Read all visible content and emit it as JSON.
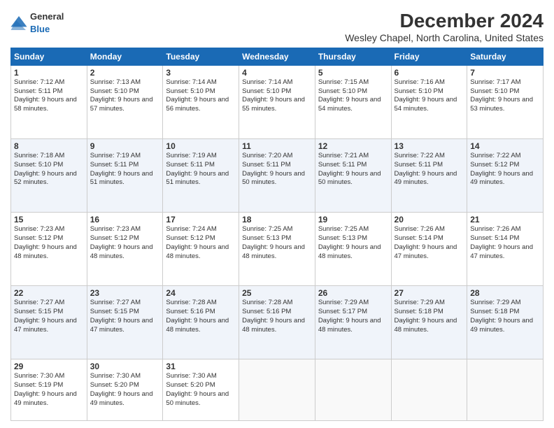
{
  "header": {
    "logo_general": "General",
    "logo_blue": "Blue",
    "month_title": "December 2024",
    "location": "Wesley Chapel, North Carolina, United States"
  },
  "weekdays": [
    "Sunday",
    "Monday",
    "Tuesday",
    "Wednesday",
    "Thursday",
    "Friday",
    "Saturday"
  ],
  "weeks": [
    [
      {
        "day": "1",
        "sunrise": "Sunrise: 7:12 AM",
        "sunset": "Sunset: 5:11 PM",
        "daylight": "Daylight: 9 hours and 58 minutes."
      },
      {
        "day": "2",
        "sunrise": "Sunrise: 7:13 AM",
        "sunset": "Sunset: 5:10 PM",
        "daylight": "Daylight: 9 hours and 57 minutes."
      },
      {
        "day": "3",
        "sunrise": "Sunrise: 7:14 AM",
        "sunset": "Sunset: 5:10 PM",
        "daylight": "Daylight: 9 hours and 56 minutes."
      },
      {
        "day": "4",
        "sunrise": "Sunrise: 7:14 AM",
        "sunset": "Sunset: 5:10 PM",
        "daylight": "Daylight: 9 hours and 55 minutes."
      },
      {
        "day": "5",
        "sunrise": "Sunrise: 7:15 AM",
        "sunset": "Sunset: 5:10 PM",
        "daylight": "Daylight: 9 hours and 54 minutes."
      },
      {
        "day": "6",
        "sunrise": "Sunrise: 7:16 AM",
        "sunset": "Sunset: 5:10 PM",
        "daylight": "Daylight: 9 hours and 54 minutes."
      },
      {
        "day": "7",
        "sunrise": "Sunrise: 7:17 AM",
        "sunset": "Sunset: 5:10 PM",
        "daylight": "Daylight: 9 hours and 53 minutes."
      }
    ],
    [
      {
        "day": "8",
        "sunrise": "Sunrise: 7:18 AM",
        "sunset": "Sunset: 5:10 PM",
        "daylight": "Daylight: 9 hours and 52 minutes."
      },
      {
        "day": "9",
        "sunrise": "Sunrise: 7:19 AM",
        "sunset": "Sunset: 5:11 PM",
        "daylight": "Daylight: 9 hours and 51 minutes."
      },
      {
        "day": "10",
        "sunrise": "Sunrise: 7:19 AM",
        "sunset": "Sunset: 5:11 PM",
        "daylight": "Daylight: 9 hours and 51 minutes."
      },
      {
        "day": "11",
        "sunrise": "Sunrise: 7:20 AM",
        "sunset": "Sunset: 5:11 PM",
        "daylight": "Daylight: 9 hours and 50 minutes."
      },
      {
        "day": "12",
        "sunrise": "Sunrise: 7:21 AM",
        "sunset": "Sunset: 5:11 PM",
        "daylight": "Daylight: 9 hours and 50 minutes."
      },
      {
        "day": "13",
        "sunrise": "Sunrise: 7:22 AM",
        "sunset": "Sunset: 5:11 PM",
        "daylight": "Daylight: 9 hours and 49 minutes."
      },
      {
        "day": "14",
        "sunrise": "Sunrise: 7:22 AM",
        "sunset": "Sunset: 5:12 PM",
        "daylight": "Daylight: 9 hours and 49 minutes."
      }
    ],
    [
      {
        "day": "15",
        "sunrise": "Sunrise: 7:23 AM",
        "sunset": "Sunset: 5:12 PM",
        "daylight": "Daylight: 9 hours and 48 minutes."
      },
      {
        "day": "16",
        "sunrise": "Sunrise: 7:23 AM",
        "sunset": "Sunset: 5:12 PM",
        "daylight": "Daylight: 9 hours and 48 minutes."
      },
      {
        "day": "17",
        "sunrise": "Sunrise: 7:24 AM",
        "sunset": "Sunset: 5:12 PM",
        "daylight": "Daylight: 9 hours and 48 minutes."
      },
      {
        "day": "18",
        "sunrise": "Sunrise: 7:25 AM",
        "sunset": "Sunset: 5:13 PM",
        "daylight": "Daylight: 9 hours and 48 minutes."
      },
      {
        "day": "19",
        "sunrise": "Sunrise: 7:25 AM",
        "sunset": "Sunset: 5:13 PM",
        "daylight": "Daylight: 9 hours and 48 minutes."
      },
      {
        "day": "20",
        "sunrise": "Sunrise: 7:26 AM",
        "sunset": "Sunset: 5:14 PM",
        "daylight": "Daylight: 9 hours and 47 minutes."
      },
      {
        "day": "21",
        "sunrise": "Sunrise: 7:26 AM",
        "sunset": "Sunset: 5:14 PM",
        "daylight": "Daylight: 9 hours and 47 minutes."
      }
    ],
    [
      {
        "day": "22",
        "sunrise": "Sunrise: 7:27 AM",
        "sunset": "Sunset: 5:15 PM",
        "daylight": "Daylight: 9 hours and 47 minutes."
      },
      {
        "day": "23",
        "sunrise": "Sunrise: 7:27 AM",
        "sunset": "Sunset: 5:15 PM",
        "daylight": "Daylight: 9 hours and 47 minutes."
      },
      {
        "day": "24",
        "sunrise": "Sunrise: 7:28 AM",
        "sunset": "Sunset: 5:16 PM",
        "daylight": "Daylight: 9 hours and 48 minutes."
      },
      {
        "day": "25",
        "sunrise": "Sunrise: 7:28 AM",
        "sunset": "Sunset: 5:16 PM",
        "daylight": "Daylight: 9 hours and 48 minutes."
      },
      {
        "day": "26",
        "sunrise": "Sunrise: 7:29 AM",
        "sunset": "Sunset: 5:17 PM",
        "daylight": "Daylight: 9 hours and 48 minutes."
      },
      {
        "day": "27",
        "sunrise": "Sunrise: 7:29 AM",
        "sunset": "Sunset: 5:18 PM",
        "daylight": "Daylight: 9 hours and 48 minutes."
      },
      {
        "day": "28",
        "sunrise": "Sunrise: 7:29 AM",
        "sunset": "Sunset: 5:18 PM",
        "daylight": "Daylight: 9 hours and 49 minutes."
      }
    ],
    [
      {
        "day": "29",
        "sunrise": "Sunrise: 7:30 AM",
        "sunset": "Sunset: 5:19 PM",
        "daylight": "Daylight: 9 hours and 49 minutes."
      },
      {
        "day": "30",
        "sunrise": "Sunrise: 7:30 AM",
        "sunset": "Sunset: 5:20 PM",
        "daylight": "Daylight: 9 hours and 49 minutes."
      },
      {
        "day": "31",
        "sunrise": "Sunrise: 7:30 AM",
        "sunset": "Sunset: 5:20 PM",
        "daylight": "Daylight: 9 hours and 50 minutes."
      },
      null,
      null,
      null,
      null
    ]
  ]
}
